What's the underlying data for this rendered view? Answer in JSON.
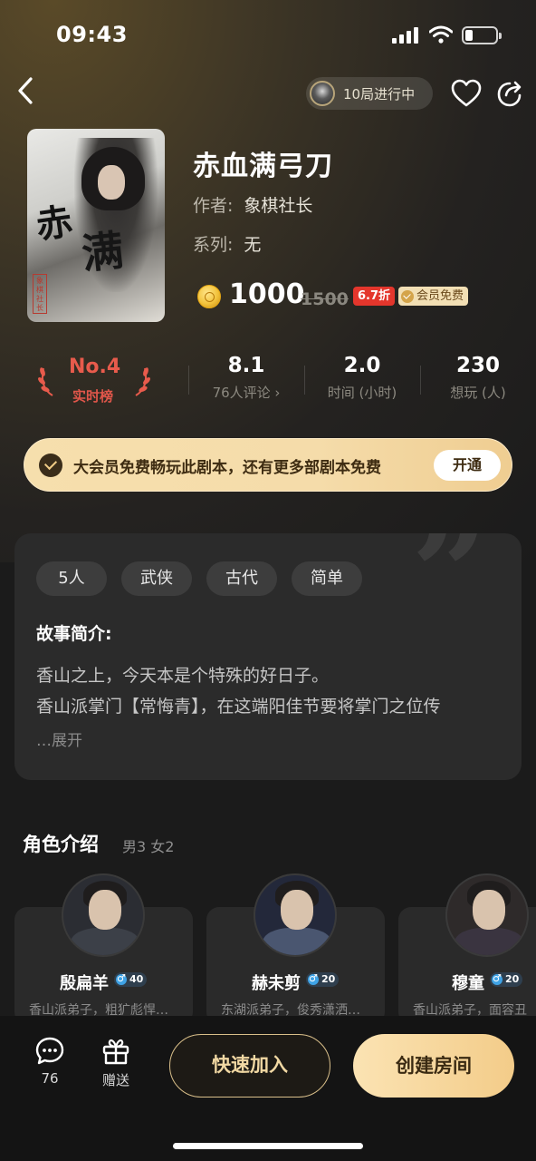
{
  "status_bar": {
    "time": "09:43"
  },
  "nav": {
    "rounds_label": "10局进行中"
  },
  "script": {
    "title": "赤血满弓刀",
    "author_label": "作者:",
    "author": "象棋社长",
    "series_label": "系列:",
    "series": "无",
    "price": "1000",
    "original_price": "1500",
    "discount": "6.7折",
    "vip_free": "会员免费"
  },
  "stats": {
    "rank": "No.4",
    "rank_label": "实时榜",
    "rating": "8.1",
    "reviews": "76人评论 ›",
    "duration": "2.0",
    "duration_label": "时间 (小时)",
    "want": "230",
    "want_label": "想玩 (人)"
  },
  "vip_banner": {
    "text": "大会员免费畅玩此剧本，还有更多部剧本免费",
    "button": "开通"
  },
  "story": {
    "tags": [
      "5人",
      "武侠",
      "古代",
      "简单"
    ],
    "heading": "故事简介:",
    "lines": [
      "香山之上，今天本是个特殊的好日子。",
      "香山派掌门【常悔青】，在这端阳佳节要将掌门之位传"
    ],
    "expand": "…展开"
  },
  "characters": {
    "title": "角色介绍",
    "summary": "男3 女2",
    "items": [
      {
        "name": "殷扁羊",
        "age": "40",
        "desc": "香山派弟子，粗犷彪悍…"
      },
      {
        "name": "赫未剪",
        "age": "20",
        "desc": "东湖派弟子，俊秀潇洒…"
      },
      {
        "name": "穆童",
        "age": "20",
        "desc": "香山派弟子，面容丑"
      }
    ]
  },
  "bottom_bar": {
    "comment_count": "76",
    "gift_label": "赠送",
    "quick_join": "快速加入",
    "create_room": "创建房间"
  },
  "colors": {
    "accent_gold": "#f3cc89",
    "rank_red": "#e85b4c",
    "discount_red": "#e4362c",
    "male_blue": "#3fa3e6"
  }
}
